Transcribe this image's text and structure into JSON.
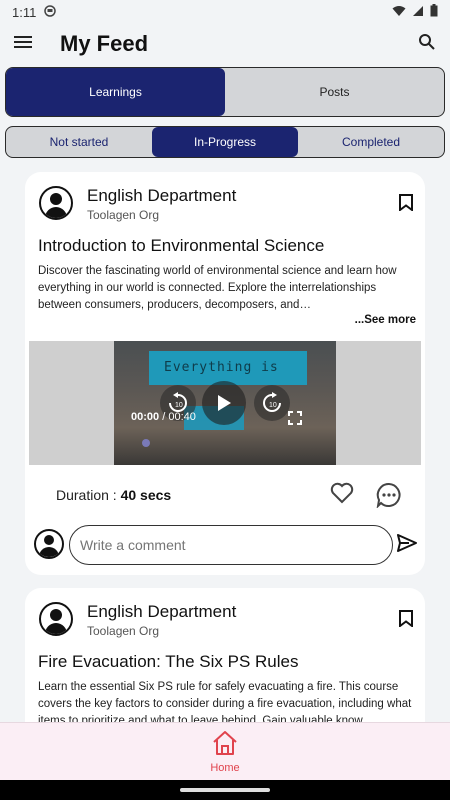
{
  "status": {
    "time": "1:11"
  },
  "appbar": {
    "title": "My Feed"
  },
  "main_tabs": [
    {
      "label": "Learnings",
      "active": true
    },
    {
      "label": "Posts",
      "active": false
    }
  ],
  "sub_tabs": [
    {
      "label": "Not started",
      "active": false
    },
    {
      "label": "In-Progress",
      "active": true
    },
    {
      "label": "Completed",
      "active": false
    }
  ],
  "posts": [
    {
      "department": "English Department",
      "org": "Toolagen Org",
      "title": "Introduction to Environmental Science",
      "description": "Discover the fascinating world of environmental science and learn how everything in our world is connected. Explore the interrelationships between consumers, producers, decomposers, and…",
      "see_more": "...See more",
      "video": {
        "overlay_text": "Everything is",
        "current_time": "00:00",
        "separator": "/",
        "total_time": "00:40"
      },
      "duration_label": "Duration : ",
      "duration_value": "40 secs",
      "comment_placeholder": "Write a comment"
    },
    {
      "department": "English Department",
      "org": "Toolagen Org",
      "title": "Fire Evacuation: The Six PS Rules",
      "description": "Learn the essential Six PS rule for safely evacuating a fire. This course covers the key factors to consider during a fire evacuation, including what items to prioritize and what to leave behind. Gain valuable know"
    }
  ],
  "bottom_nav": {
    "home_label": "Home"
  },
  "colors": {
    "primary": "#1b2470",
    "accent": "#e0434d",
    "nav_bg": "#fbeef5"
  }
}
